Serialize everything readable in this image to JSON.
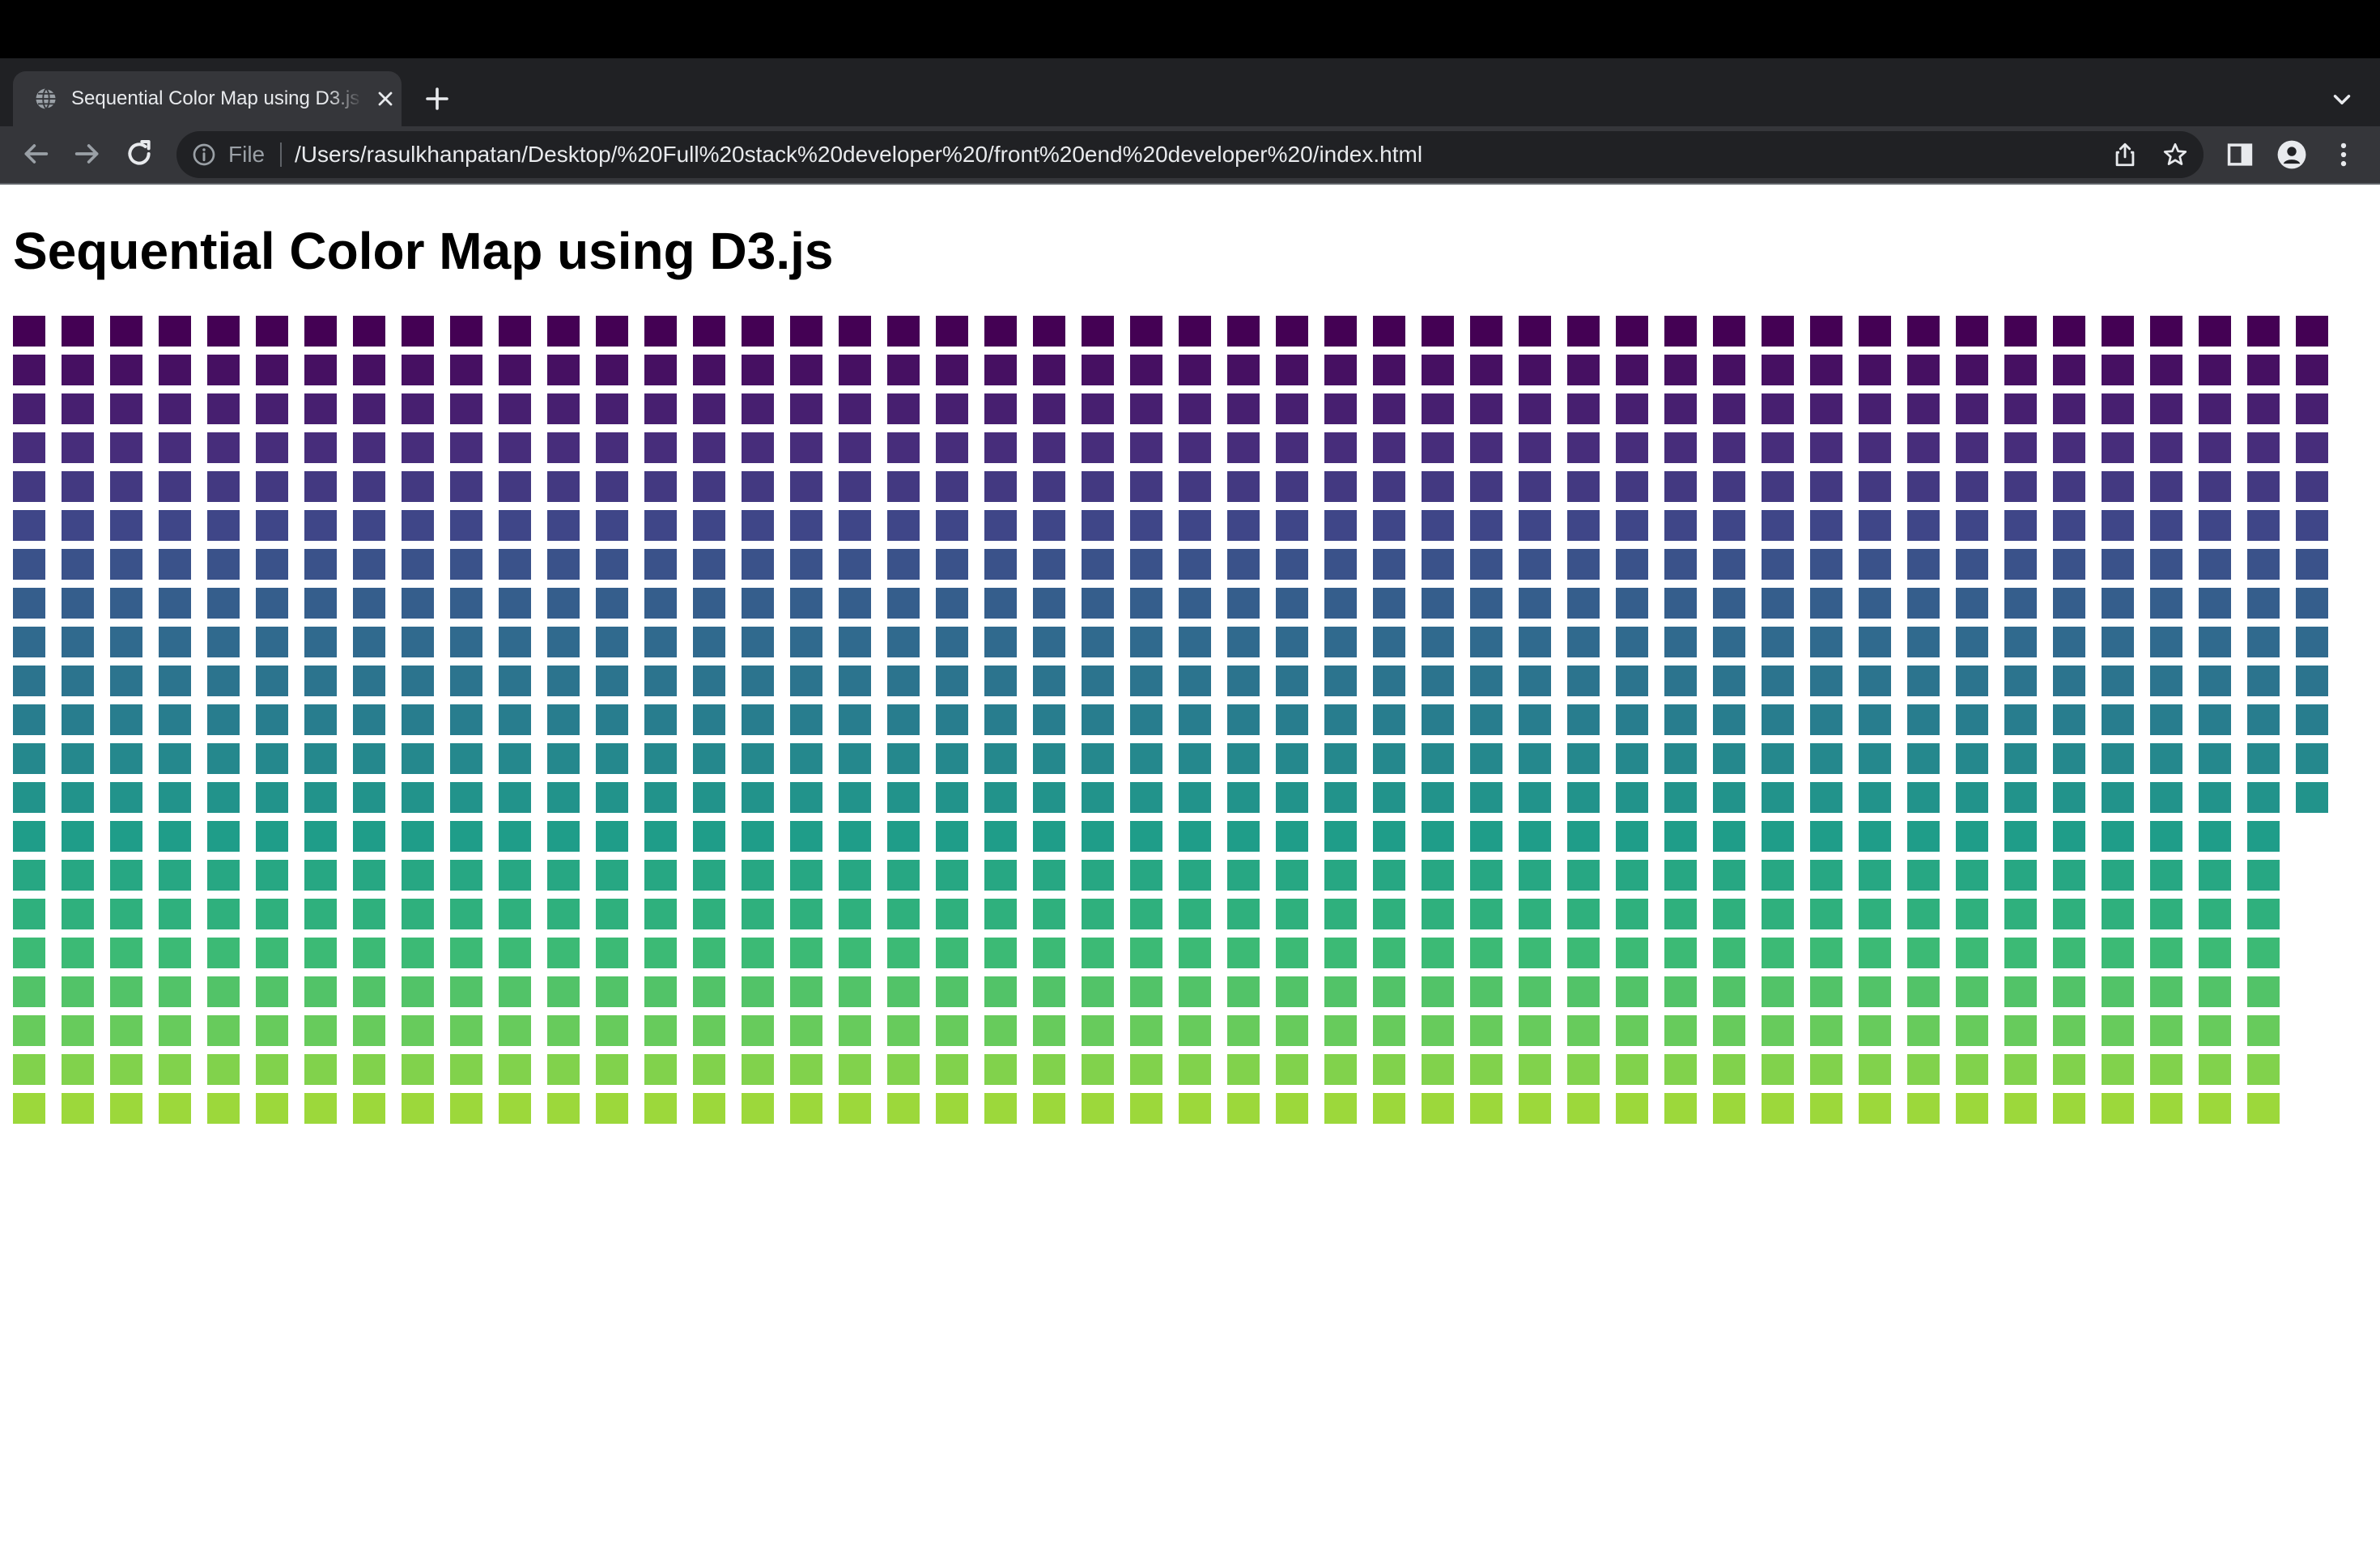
{
  "browser": {
    "tab": {
      "title": "Sequential Color Map using D3.js",
      "favicon": "globe-icon",
      "close_icon": "close-icon"
    },
    "new_tab_icon": "plus-icon",
    "tab_search_icon": "chevron-down-icon",
    "toolbar": {
      "back_icon": "arrow-left-icon",
      "forward_icon": "arrow-right-icon",
      "reload_icon": "reload-icon",
      "omnibox": {
        "info_icon": "info-icon",
        "scheme": "File",
        "url": "/Users/rasulkhanpatan/Desktop/%20Full%20stack%20developer%20/front%20end%20developer%20/index.html",
        "share_icon": "share-icon",
        "bookmark_icon": "star-icon"
      },
      "side_panel_icon": "side-panel-icon",
      "profile_icon": "profile-icon",
      "menu_icon": "kebab-menu-icon"
    }
  },
  "page": {
    "heading": "Sequential Color Map using D3.js"
  },
  "chart_data": {
    "type": "heatmap",
    "colormap": "viridis",
    "columns": 48,
    "rows": 21,
    "cell_count": 1000,
    "fill_order": "column-major",
    "domain": [
      0,
      1000
    ],
    "stops": [
      "#440154",
      "#482878",
      "#3e4989",
      "#31688e",
      "#26828e",
      "#1f9e89",
      "#35b779",
      "#6ece58",
      "#b5de2b",
      "#fde725"
    ],
    "display_range": [
      0.0,
      0.85
    ]
  }
}
